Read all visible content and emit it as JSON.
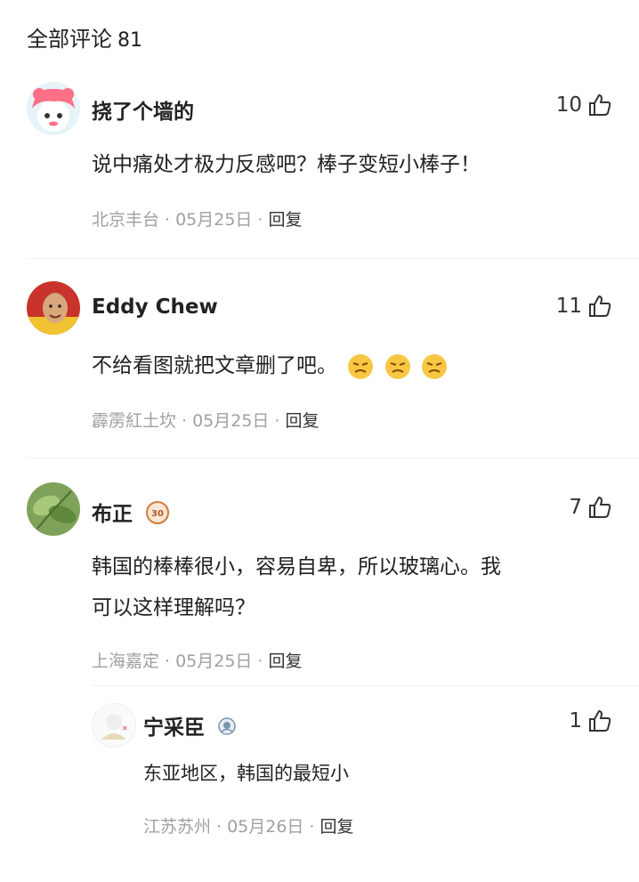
{
  "header": {
    "title": "全部评论",
    "count": "81"
  },
  "comments": [
    {
      "user": "挠了个墙的",
      "likes": "10",
      "text": "说中痛处才极力反感吧？棒子变短小棒子！",
      "location": "北京丰台",
      "date": "05月25日",
      "reply": "回复"
    },
    {
      "user": "Eddy Chew",
      "likes": "11",
      "text": "不给看图就把文章删了吧。",
      "location": "霹雳紅土坎",
      "date": "05月25日",
      "reply": "回复"
    },
    {
      "user": "布正",
      "likes": "7",
      "badge": "30",
      "text_line1": "韩国的棒棒很小，容易自卑，所以玻璃心。我",
      "text_line2": "可以这样理解吗？",
      "location": "上海嘉定",
      "date": "05月25日",
      "reply": "回复"
    }
  ],
  "reply": {
    "user": "宁采臣",
    "likes": "1",
    "text": "东亚地区，韩国的最短小",
    "location": "江苏苏州",
    "date": "05月26日",
    "reply": "回复"
  },
  "colors": {
    "meta": "#a0a0a0",
    "emoji": "#f7c744"
  }
}
